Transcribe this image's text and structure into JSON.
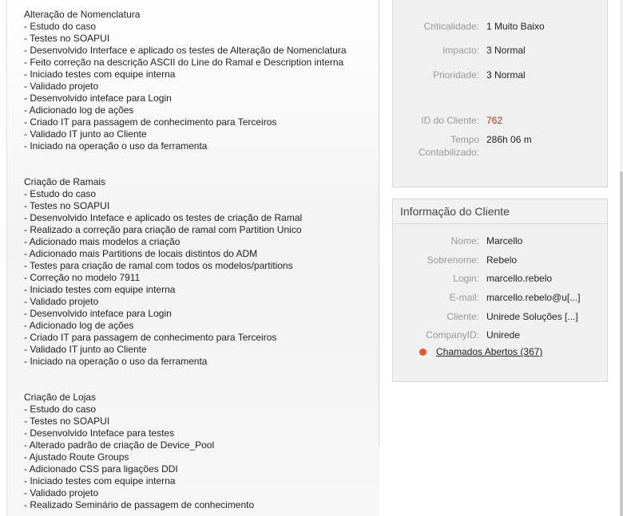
{
  "notes": [
    {
      "title": "Alteração de Nomenclatura",
      "items": [
        "- Estudo do caso",
        "- Testes no SOAPUI",
        "- Desenvolvido Interface e aplicado os testes de Alteração de Nomenclatura",
        "- Feito correção na descrição ASCII do Line do Ramal e Description interna",
        "- Iniciado testes com equipe interna",
        "- Validado projeto",
        "- Desenvolvido inteface para Login",
        "- Adicionado log de ações",
        "- Criado IT para passagem de conhecimento para Terceiros",
        "- Validado IT junto ao Cliente",
        "- Iniciado na operação o uso da ferramenta"
      ]
    },
    {
      "title": "Criação de Ramais",
      "items": [
        "- Estudo do caso",
        "- Testes no SOAPUI",
        "- Desenvolvido Inteface e aplicado os testes de criação de Ramal",
        "- Realizado a correção para criação de ramal com Partition Unico",
        "- Adicionado mais modelos a criação",
        "- Adicionado mais Partitions de locais distintos do ADM",
        "- Testes para criação de ramal com todos os modelos/partitions",
        "- Correção no modelo 7911",
        "- Iniciado testes com equipe interna",
        "- Validado projeto",
        "- Desenvolvido inteface para Login",
        "- Adicionado log de ações",
        "- Criado IT para passagem de conhecimento para Terceiros",
        "- Validado IT junto ao Cliente",
        "- Iniciado na operação o uso da ferramenta"
      ]
    },
    {
      "title": "Criação de Lojas",
      "items": [
        "- Estudo do caso",
        "- Testes no SOAPUI",
        "- Desenvolvido Inteface para testes",
        "- Alterado padrão de criação de  Device_Pool",
        "- Ajustado Route Groups",
        "- Adicionado CSS para ligações DDI",
        "- Iniciado testes com equipe interna",
        "- Validado projeto",
        "- Realizado Seminário de passagem de conhecimento"
      ]
    }
  ],
  "ticket": {
    "criticidade_label": "Criticalidade:",
    "criticidade_value": "1 Muito Baixo",
    "impacto_label": "Impacto:",
    "impacto_value": "3 Normal",
    "prioridade_label": "Prioridade:",
    "prioridade_value": "3 Normal",
    "id_cliente_label": "ID do Cliente:",
    "id_cliente_value": "762",
    "tempo_label": "Tempo Contabilizado:",
    "tempo_value": "286h 06 m"
  },
  "cliente": {
    "header": "Informação do Cliente",
    "nome_label": "Nome:",
    "nome_value": "Marcello",
    "sobrenome_label": "Sobrenome:",
    "sobrenome_value": "Rebelo",
    "login_label": "Login:",
    "login_value": "marcello.rebelo",
    "email_label": "E-mail:",
    "email_value": "marcello.rebelo@u[...]",
    "cliente_label": "Cliente:",
    "cliente_value": "Unirede Soluções [...]",
    "companyid_label": "CompanyID:",
    "companyid_value": "Unirede",
    "chamados_link": "Chamados Abertos (367)",
    "status_dot_color": "#e05a2a"
  }
}
